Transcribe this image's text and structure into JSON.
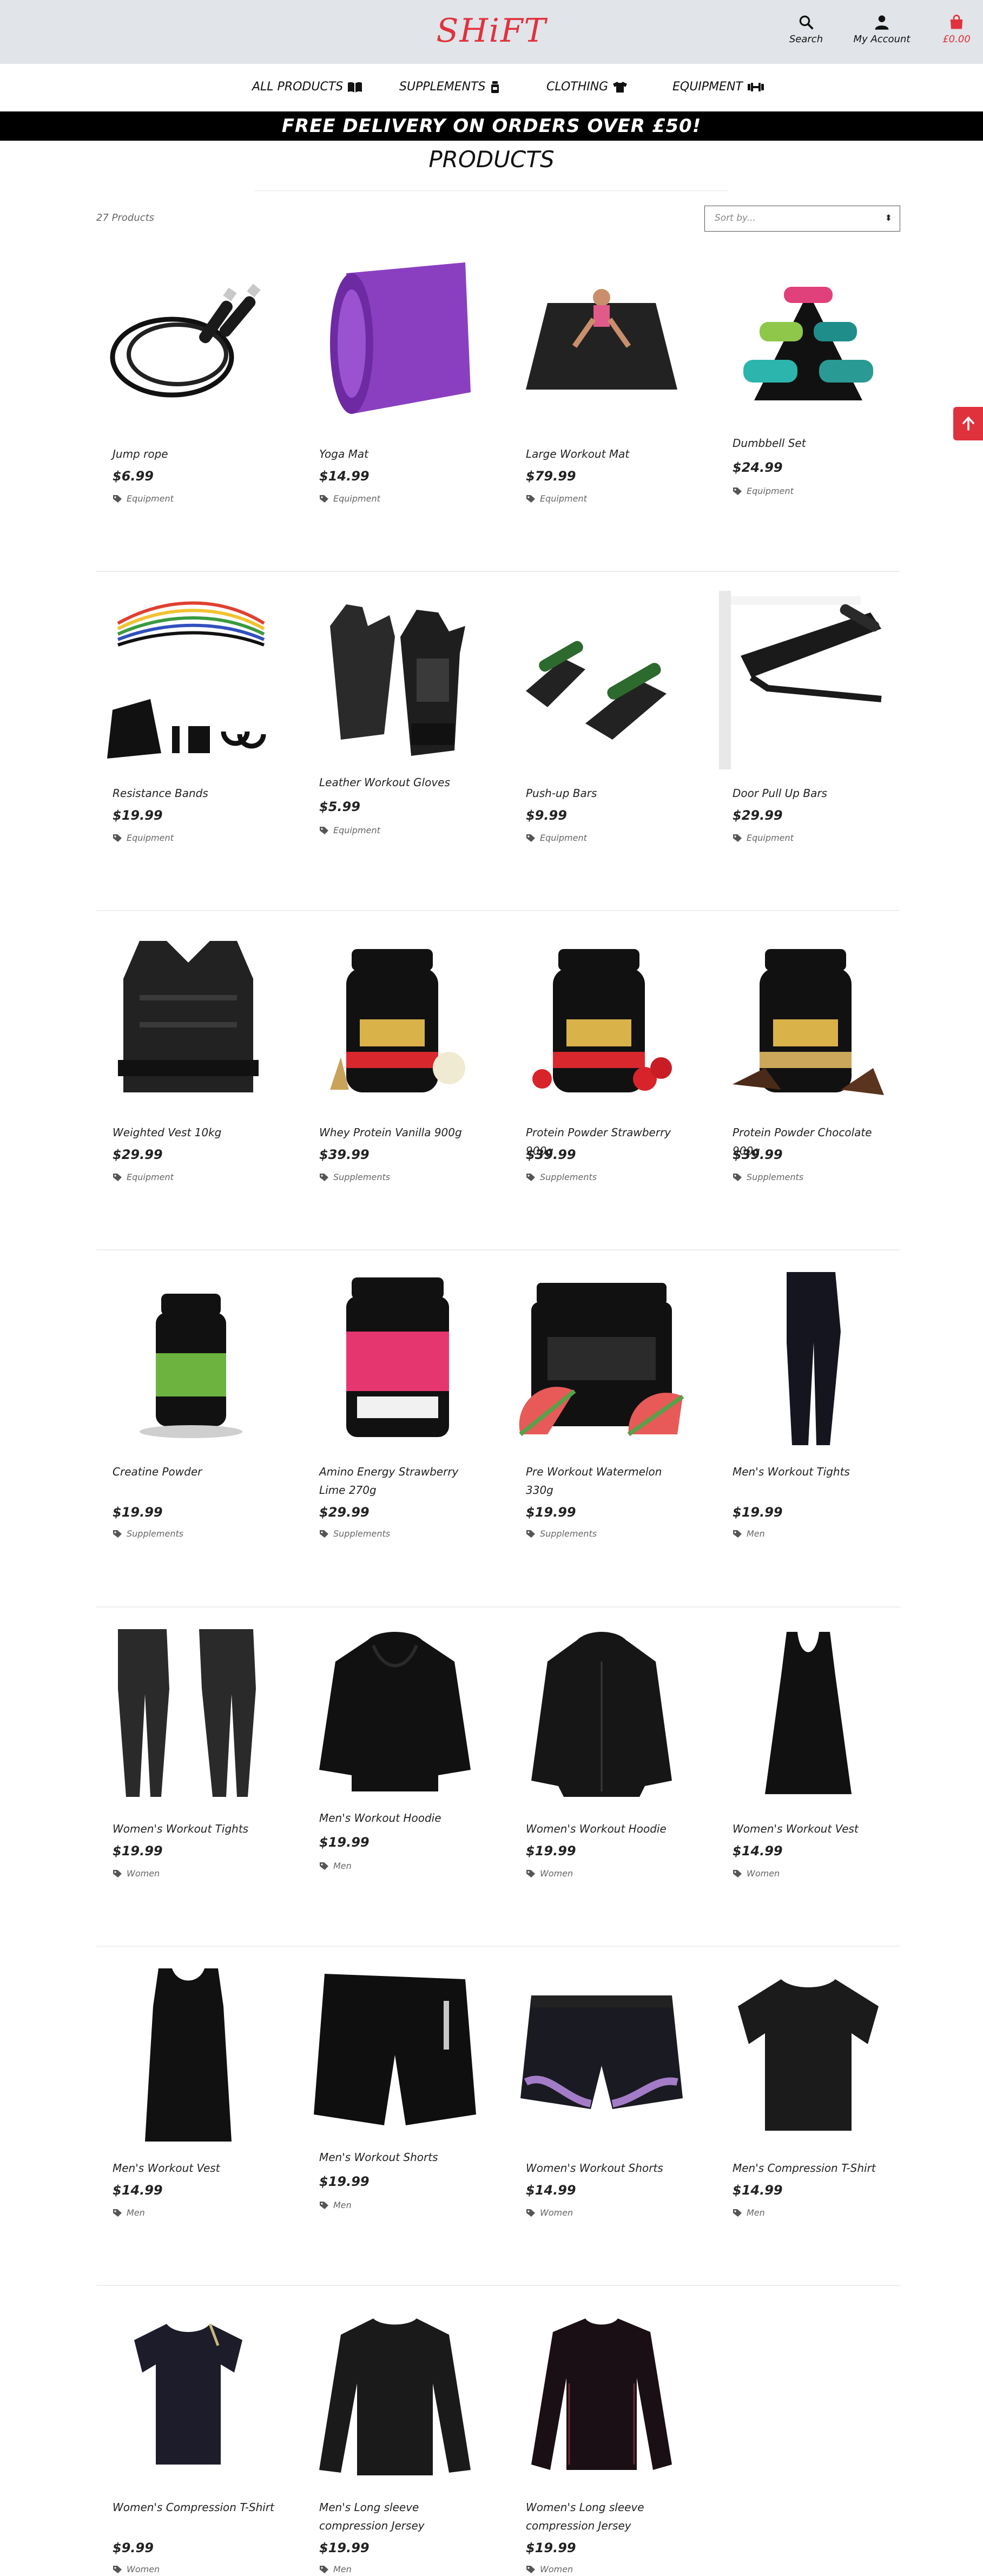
{
  "header": {
    "logo": "SHiFT",
    "search_label": "Search",
    "account_label": "My Account",
    "basket_total": "£0.00"
  },
  "nav": {
    "all_products": "ALL PRODUCTS",
    "supplements": "SUPPLEMENTS",
    "clothing": "CLOTHING",
    "equipment": "EQUIPMENT"
  },
  "banner": "FREE DELIVERY ON ORDERS OVER £50!",
  "page_title": "PRODUCTS",
  "product_count": "27 Products",
  "sort": {
    "placeholder": "Sort by..."
  },
  "colors": {
    "brand": "#e0323d",
    "header_bg": "#e1e4e8",
    "banner_bg": "#000000"
  },
  "products": [
    {
      "name": "Jump rope",
      "price": "$6.99",
      "category": "Equipment",
      "icon": "jump-rope-image"
    },
    {
      "name": "Yoga Mat",
      "price": "$14.99",
      "category": "Equipment",
      "icon": "yoga-mat-image"
    },
    {
      "name": "Large Workout Mat",
      "price": "$79.99",
      "category": "Equipment",
      "icon": "large-mat-image"
    },
    {
      "name": "Dumbbell Set",
      "price": "$24.99",
      "category": "Equipment",
      "icon": "dumbbell-set-image"
    },
    {
      "name": "Resistance Bands",
      "price": "$19.99",
      "category": "Equipment",
      "icon": "resistance-bands-image"
    },
    {
      "name": "Leather Workout Gloves",
      "price": "$5.99",
      "category": "Equipment",
      "icon": "gloves-image"
    },
    {
      "name": "Push-up Bars",
      "price": "$9.99",
      "category": "Equipment",
      "icon": "pushup-bars-image"
    },
    {
      "name": "Door Pull Up Bars",
      "price": "$29.99",
      "category": "Equipment",
      "icon": "pullup-bar-image"
    },
    {
      "name": "Weighted Vest 10kg",
      "price": "$29.99",
      "category": "Equipment",
      "icon": "weighted-vest-image"
    },
    {
      "name": "Whey Protein Vanilla 900g",
      "price": "$39.99",
      "category": "Supplements",
      "icon": "whey-vanilla-image"
    },
    {
      "name": "Protein Powder Strawberry 900g",
      "price": "$39.99",
      "category": "Supplements",
      "icon": "whey-strawberry-image"
    },
    {
      "name": "Protein Powder Chocolate 900g",
      "price": "$39.99",
      "category": "Supplements",
      "icon": "whey-chocolate-image"
    },
    {
      "name": "Creatine Powder",
      "price": "$19.99",
      "category": "Supplements",
      "icon": "creatine-image"
    },
    {
      "name": "Amino Energy Strawberry Lime 270g",
      "price": "$29.99",
      "category": "Supplements",
      "icon": "amino-energy-image"
    },
    {
      "name": "Pre Workout Watermelon 330g",
      "price": "$19.99",
      "category": "Supplements",
      "icon": "pre-workout-image"
    },
    {
      "name": "Men's Workout Tights",
      "price": "$19.99",
      "category": "Men",
      "icon": "mens-tights-image"
    },
    {
      "name": "Women's Workout Tights",
      "price": "$19.99",
      "category": "Women",
      "icon": "womens-tights-image"
    },
    {
      "name": "Men's Workout Hoodie",
      "price": "$19.99",
      "category": "Men",
      "icon": "mens-hoodie-image"
    },
    {
      "name": "Women's Workout Hoodie",
      "price": "$19.99",
      "category": "Women",
      "icon": "womens-hoodie-image"
    },
    {
      "name": "Women's Workout Vest",
      "price": "$14.99",
      "category": "Women",
      "icon": "womens-vest-image"
    },
    {
      "name": "Men's Workout Vest",
      "price": "$14.99",
      "category": "Men",
      "icon": "mens-vest-image"
    },
    {
      "name": "Men's Workout Shorts",
      "price": "$19.99",
      "category": "Men",
      "icon": "mens-shorts-image"
    },
    {
      "name": "Women's Workout Shorts",
      "price": "$14.99",
      "category": "Women",
      "icon": "womens-shorts-image"
    },
    {
      "name": "Men's Compression T-Shirt",
      "price": "$14.99",
      "category": "Men",
      "icon": "mens-compression-tee-image"
    },
    {
      "name": "Women's Compression T-Shirt",
      "price": "$9.99",
      "category": "Women",
      "icon": "womens-compression-tee-image"
    },
    {
      "name": "Men's Long sleeve compression Jersey",
      "price": "$19.99",
      "category": "Men",
      "icon": "mens-longsleeve-image"
    },
    {
      "name": "Women's Long sleeve compression Jersey",
      "price": "$19.99",
      "category": "Women",
      "icon": "womens-longsleeve-image"
    }
  ]
}
